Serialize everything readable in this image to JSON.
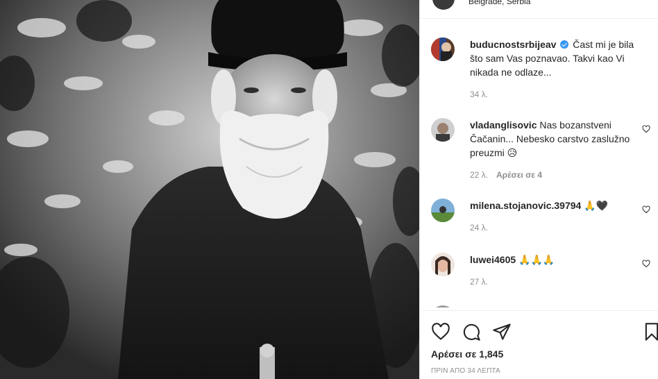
{
  "post": {
    "location": "Belgrade, Serbia",
    "likes_text": "Αρέσει σε 1,845",
    "time_text": "ΠΡΙΝ ΑΠΟ 34 ΛΕΠΤΑ"
  },
  "caption": {
    "username": "buducnostsrbijeav",
    "verified": true,
    "text": "Čast mi je bila što sam Vas poznavao. Takvi kao Vi nikada ne odlaze...",
    "time": "34 λ."
  },
  "comments": [
    {
      "username": "vladanglisovic",
      "text": "Nas bozanstveni Čačanin... Nebesko carstvo zaslužno preuzmi 😥",
      "time": "22 λ.",
      "likes": "Αρέσει σε 4"
    },
    {
      "username": "milena.stojanovic.39794",
      "text": "🙏🖤",
      "time": "24 λ."
    },
    {
      "username": "luwei4605",
      "text": "🙏🙏🙏",
      "time": "27 λ."
    }
  ],
  "icons": {
    "like": "heart-icon",
    "comment": "comment-icon",
    "share": "share-icon",
    "save": "bookmark-icon"
  }
}
